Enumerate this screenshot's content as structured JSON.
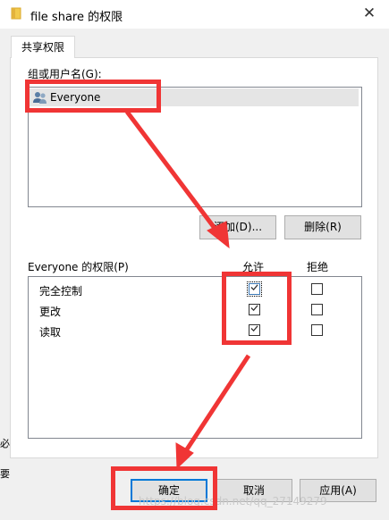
{
  "window": {
    "title": "file share 的权限",
    "close_glyph": "✕"
  },
  "tabs": [
    {
      "label": "共享权限"
    }
  ],
  "users_group": {
    "label": "组或用户名(G):",
    "items": [
      {
        "name": "Everyone",
        "icon": "users-icon"
      }
    ],
    "add_button": "添加(D)...",
    "remove_button": "删除(R)"
  },
  "permissions": {
    "label": "Everyone 的权限(P)",
    "allow_header": "允许",
    "deny_header": "拒绝",
    "rows": [
      {
        "name": "完全控制",
        "allow": true,
        "deny": false
      },
      {
        "name": "更改",
        "allow": true,
        "deny": false
      },
      {
        "name": "读取",
        "allow": true,
        "deny": false
      }
    ]
  },
  "footer": {
    "ok_button": "确定",
    "cancel_button": "取消",
    "apply_button": "应用(A)"
  },
  "background_fragments": [
    "必",
    "要"
  ],
  "watermark": "https://blog.csdn.net/qq_27149279",
  "colors": {
    "annotation_red": "#f03535",
    "focus_blue": "#0078d7",
    "selection_gray": "#e5e5e5"
  }
}
